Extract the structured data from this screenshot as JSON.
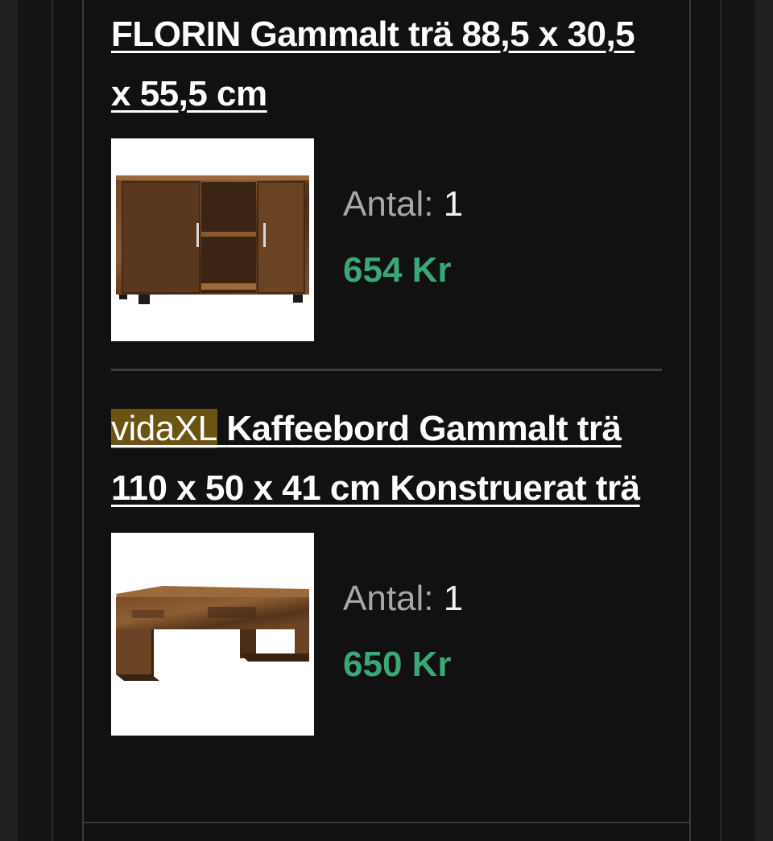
{
  "cart": {
    "items": [
      {
        "brand": "",
        "title": "FLORIN Gammalt trä 88,5 x 30,5 x 55,5 cm",
        "quantity_label": "Antal:",
        "quantity": "1",
        "price": "654 Kr",
        "image_icon": "sideboard-image"
      },
      {
        "brand": "vidaXL",
        "title": "Kaffeebord Gammalt trä 110 x 50 x 41 cm Konstruerat trä",
        "quantity_label": "Antal:",
        "quantity": "1",
        "price": "650 Kr",
        "image_icon": "coffee-table-image"
      }
    ]
  },
  "colors": {
    "background": "#121212",
    "price": "#3aa876",
    "brand_highlight": "#6b5412",
    "divider": "#3d3d3d"
  }
}
